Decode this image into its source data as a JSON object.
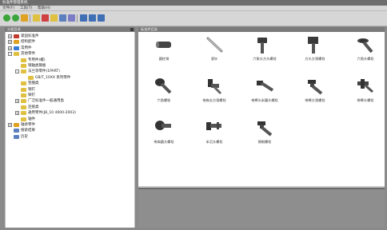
{
  "window": {
    "title": "标准件管理系统"
  },
  "menu": [
    "文件(F)",
    "工具(T)",
    "帮助(H)"
  ],
  "toolbar": {
    "buttons": [
      {
        "icon": "new-icon",
        "color": "#3aa53a"
      },
      {
        "icon": "open-icon",
        "color": "#3aa53a"
      },
      {
        "icon": "refresh-icon",
        "color": "#e0a020"
      },
      {
        "icon": "back-icon",
        "color": "#e0c040"
      },
      {
        "icon": "forward-icon",
        "color": "#d04040"
      },
      {
        "icon": "folder-icon",
        "color": "#e0c040"
      },
      {
        "icon": "search-icon",
        "color": "#5b7fbf"
      },
      {
        "icon": "copy-icon",
        "color": "#7c7cc6"
      },
      {
        "icon": "view-list-icon",
        "color": "#3f6fb5"
      },
      {
        "icon": "view-grid-icon",
        "color": "#3f6fb5"
      },
      {
        "icon": "view-detail-icon",
        "color": "#3f6fb5"
      }
    ]
  },
  "left_panel": {
    "title": "分类目录"
  },
  "right_panel": {
    "title": "标准件目录"
  },
  "tree": [
    {
      "label": "紧固标准件",
      "level": 0,
      "expander": "+",
      "color": "#c0392b"
    },
    {
      "label": "结构配件",
      "level": 0,
      "expander": "+",
      "color": "#e0a020"
    },
    {
      "label": "常用件",
      "level": 0,
      "expander": "+",
      "color": "#3a7bd5"
    },
    {
      "label": "其他零件",
      "level": 0,
      "expander": "-",
      "color": "#e0c040"
    },
    {
      "label": "专用件(螺)",
      "level": 1,
      "expander": "",
      "color": "#e0c040"
    },
    {
      "label": "销轴类钢板",
      "level": 1,
      "expander": "",
      "color": "#e0c040"
    },
    {
      "label": "法兰等零件(1PART)",
      "level": 1,
      "expander": "-",
      "color": "#e0c040"
    },
    {
      "label": "GB/T_10XX 系列零件",
      "level": 2,
      "expander": "",
      "color": "#e0c040"
    },
    {
      "label": "垫圈类",
      "level": 1,
      "expander": "",
      "color": "#e0c040"
    },
    {
      "label": "销钉",
      "level": 1,
      "expander": "",
      "color": "#e0c040"
    },
    {
      "label": "铆钉",
      "level": 1,
      "expander": "",
      "color": "#e0c040"
    },
    {
      "label": "广泛标准件一般通用类",
      "level": 1,
      "expander": "+",
      "color": "#e0c040"
    },
    {
      "label": "连接类",
      "level": 1,
      "expander": "",
      "color": "#e0c040"
    },
    {
      "label": "通用零件(JB_10 4000-2003)",
      "level": 1,
      "expander": "+",
      "color": "#e0c040"
    },
    {
      "label": "轴件",
      "level": 1,
      "expander": "",
      "color": "#e0c040"
    },
    {
      "label": "轴承零件",
      "level": 0,
      "expander": "+",
      "color": "#e0a020"
    },
    {
      "label": "搜索结果",
      "level": 0,
      "expander": "",
      "color": "#5b7fbf"
    },
    {
      "label": "历史",
      "level": 0,
      "expander": "",
      "color": "#5b7fbf"
    }
  ],
  "parts": [
    {
      "label": "圆柱销",
      "shape": "cylinder"
    },
    {
      "label": "滚针",
      "shape": "needle"
    },
    {
      "label": "六角头方头螺栓",
      "shape": "bolt-hex"
    },
    {
      "label": "方头方颈螺栓",
      "shape": "bolt-square"
    },
    {
      "label": "六角头螺栓",
      "shape": "bolt-flange"
    },
    {
      "label": "六角螺栓",
      "shape": "bolt-round"
    },
    {
      "label": "带肩长方颈螺栓",
      "shape": "bolt-shoulder"
    },
    {
      "label": "带榫头半圆头螺栓",
      "shape": "bolt-long"
    },
    {
      "label": "带榫方颈螺栓",
      "shape": "bolt-tee"
    },
    {
      "label": "带榫头螺栓",
      "shape": "bolt-cross"
    },
    {
      "label": "带肩圆头螺栓",
      "shape": "bolt-dome"
    },
    {
      "label": "半沉头螺栓",
      "shape": "bolt-short"
    },
    {
      "label": "钢制螺栓",
      "shape": "bolt-tee"
    }
  ]
}
